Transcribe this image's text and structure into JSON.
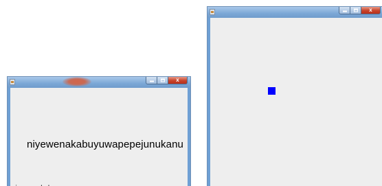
{
  "colors": {
    "titlebar": "#7ba7d6",
    "client": "#eeeeee",
    "close_button": "#c7422a",
    "square": "#0000ff"
  },
  "left_window": {
    "icon": "java-cup-icon",
    "main_label": "niyewenakabuyuwapepejunukanu",
    "status_label": "niyewenakabu"
  },
  "right_window": {
    "icon": "java-cup-icon",
    "shape": "blue-square"
  },
  "caption_buttons": {
    "minimize_icon": "minimize-icon",
    "maximize_icon": "maximize-icon",
    "close_icon": "close-icon",
    "close_glyph": "x"
  }
}
